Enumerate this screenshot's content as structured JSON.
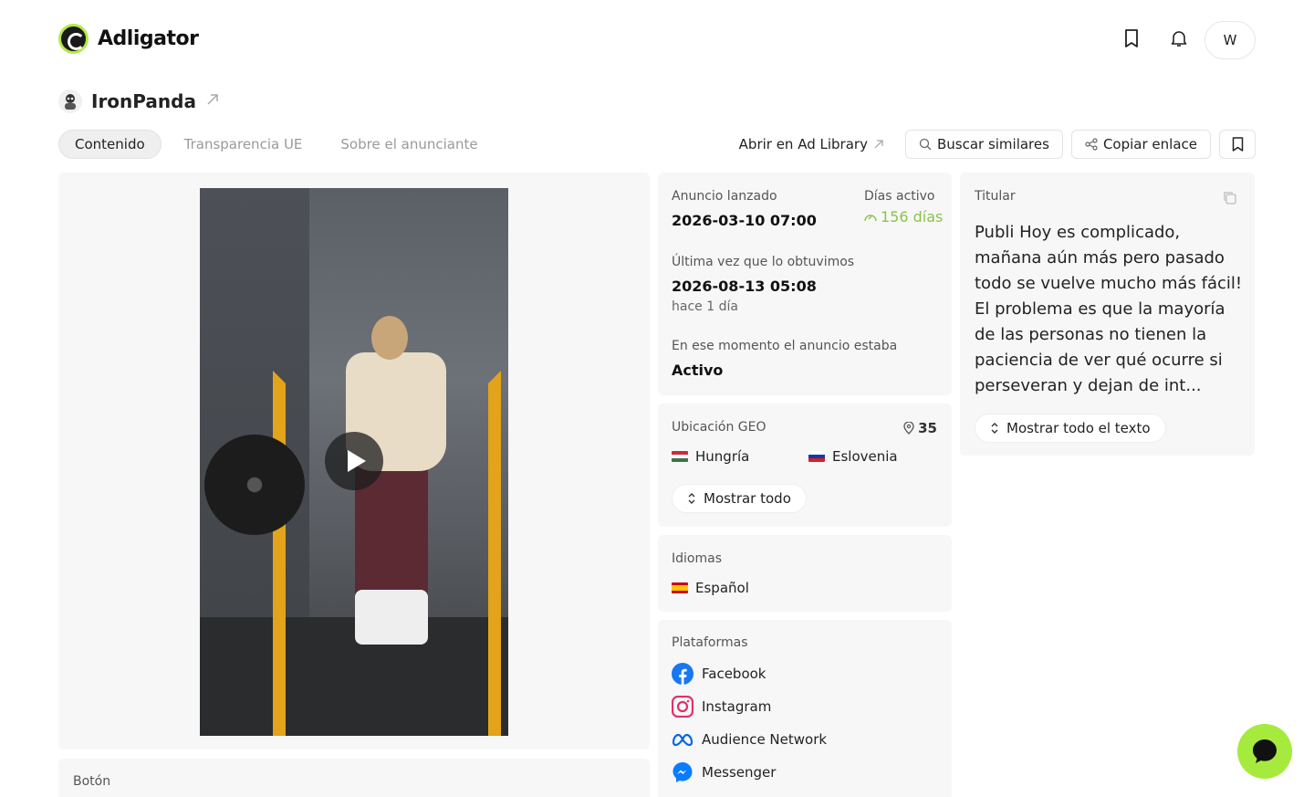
{
  "app": {
    "name": "Adligator"
  },
  "header": {
    "avatar_initial": "W"
  },
  "advertiser": {
    "name": "IronPanda"
  },
  "tabs": [
    {
      "label": "Contenido",
      "active": true
    },
    {
      "label": "Transparencia UE",
      "active": false
    },
    {
      "label": "Sobre el anunciante",
      "active": false
    }
  ],
  "actions": {
    "ad_library": "Abrir en Ad Library",
    "find_similar": "Buscar similares",
    "copy_link": "Copiar enlace"
  },
  "media_panel": {
    "button_label": "Botón"
  },
  "info": {
    "launched_label": "Anuncio lanzado",
    "launched_value": "2026-03-10 07:00",
    "days_active_label": "Días activo",
    "days_active_value": "156 días",
    "last_seen_label": "Última vez que lo obtuvimos",
    "last_seen_value": "2026-08-13 05:08",
    "last_seen_relative": "hace 1 día",
    "status_label": "En ese momento el anuncio estaba",
    "status_value": "Activo"
  },
  "geo": {
    "label": "Ubicación GEO",
    "count": "35",
    "countries": [
      "Hungría",
      "Eslovenia"
    ],
    "show_all": "Mostrar todo"
  },
  "languages": {
    "label": "Idiomas",
    "items": [
      "Español"
    ]
  },
  "platforms": {
    "label": "Plataformas",
    "items": [
      "Facebook",
      "Instagram",
      "Audience Network",
      "Messenger"
    ]
  },
  "headline": {
    "label": "Titular",
    "text": "Publi Hoy es complicado, mañana aún más pero pasado todo se vuelve mucho más fácil! El problema es que la mayoría de las personas no tienen la paciencia de ver qué ocurre si perseveran y dejan de int...",
    "show_full": "Mostrar todo el texto"
  },
  "colors": {
    "accent": "#a7ea3e",
    "days_green": "#8bc34a"
  }
}
